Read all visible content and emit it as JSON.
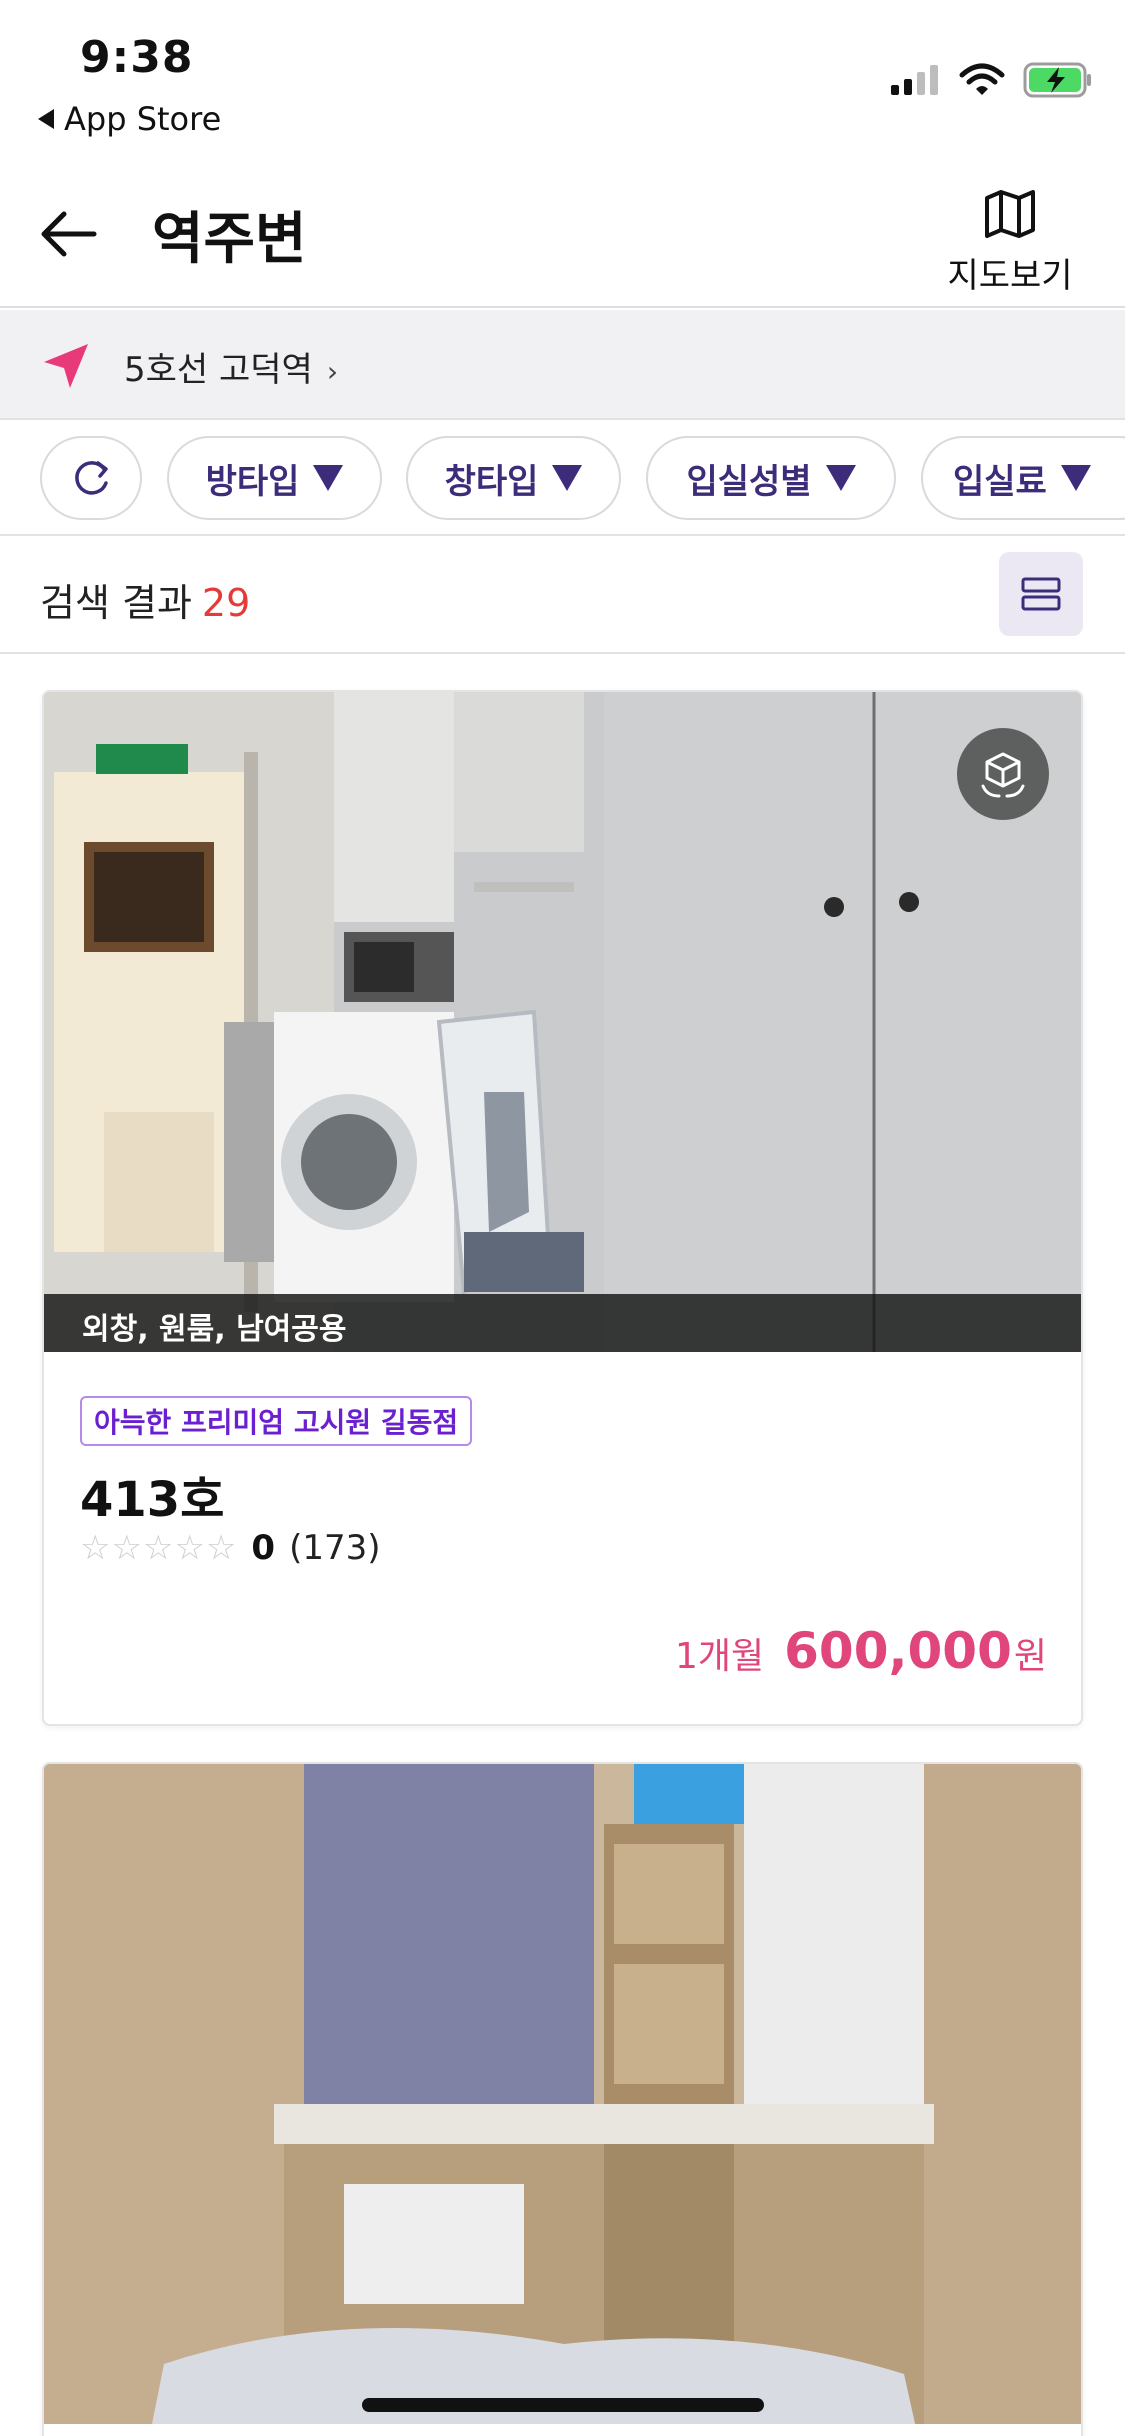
{
  "status_bar": {
    "time": "9:38",
    "back_app": "App Store",
    "icons": [
      "signal-icon",
      "wifi-icon",
      "battery-charging-icon"
    ]
  },
  "header": {
    "title": "역주변",
    "map_button_label": "지도보기"
  },
  "location": {
    "text": "5호선 고덕역",
    "chevron": "›",
    "icon": "location-arrow-icon",
    "accent_color": "#e83a78"
  },
  "filters": {
    "refresh_icon": "refresh-icon",
    "items": [
      {
        "label": "방타입"
      },
      {
        "label": "창타입"
      },
      {
        "label": "입실성별"
      },
      {
        "label": "입실료"
      }
    ]
  },
  "results": {
    "label": "검색 결과",
    "count": "29",
    "view_toggle_icon": "list-view-icon"
  },
  "listings": [
    {
      "tags": "외창, 원룸, 남여공용",
      "brand": "아늑한 프리미엄 고시원 길동점",
      "room": "413호",
      "rating": "0",
      "review_count": "(173)",
      "price_period": "1개월",
      "price_amount": "600,000",
      "price_unit": "원",
      "has_vr": true
    },
    {
      "tags": "",
      "brand": "",
      "room": "",
      "has_vr": false
    }
  ],
  "colors": {
    "brand_purple": "#3c2c7a",
    "price_pink": "#e0457b",
    "count_red": "#e53a3a",
    "tag_purple": "#6a1fd0"
  }
}
